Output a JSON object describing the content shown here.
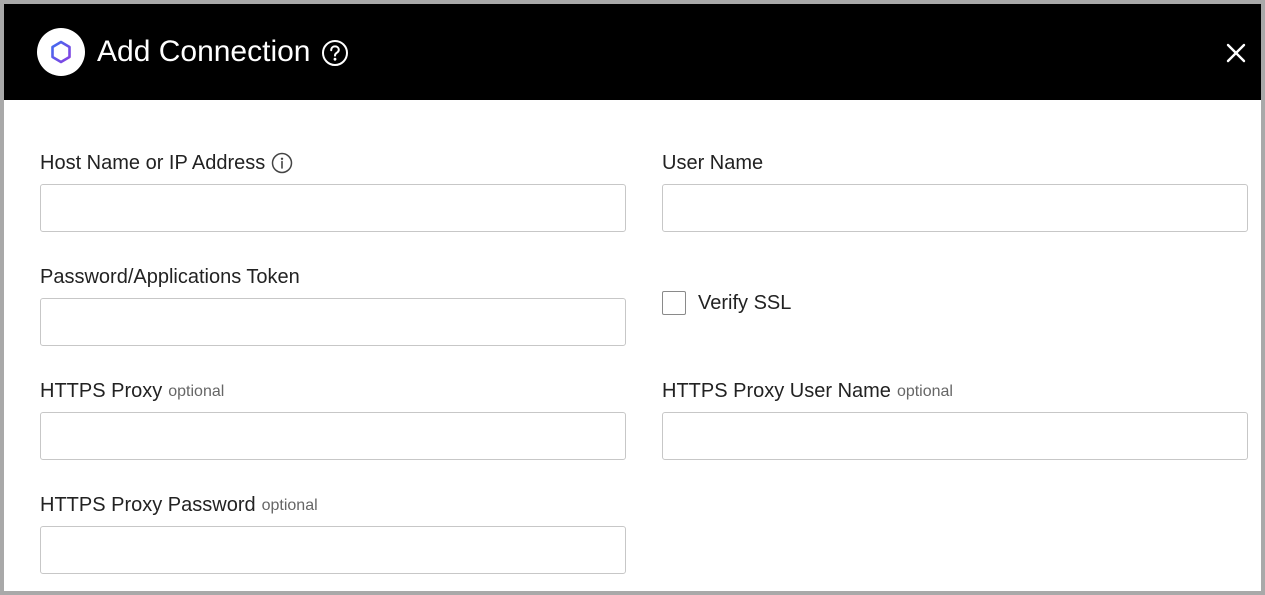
{
  "dialog": {
    "title": "Add Connection",
    "logo_icon": "hexagon-logo-icon",
    "help_icon": "help-circle-icon",
    "close_icon": "close-icon",
    "accent_color": "#6b46e0",
    "header_color": "#000000"
  },
  "form": {
    "host": {
      "label": "Host Name or IP Address",
      "info_icon": "info-icon",
      "value": "",
      "placeholder": ""
    },
    "username": {
      "label": "User Name",
      "value": "",
      "placeholder": ""
    },
    "password": {
      "label": "Password/Applications Token",
      "value": "",
      "placeholder": ""
    },
    "verify_ssl": {
      "label": "Verify SSL",
      "checked": false
    },
    "https_proxy": {
      "label": "HTTPS Proxy",
      "optional": "optional",
      "value": "",
      "placeholder": ""
    },
    "https_proxy_username": {
      "label": "HTTPS Proxy User Name",
      "optional": "optional",
      "value": "",
      "placeholder": ""
    },
    "https_proxy_password": {
      "label": "HTTPS Proxy Password",
      "optional": "optional",
      "value": "",
      "placeholder": ""
    }
  }
}
